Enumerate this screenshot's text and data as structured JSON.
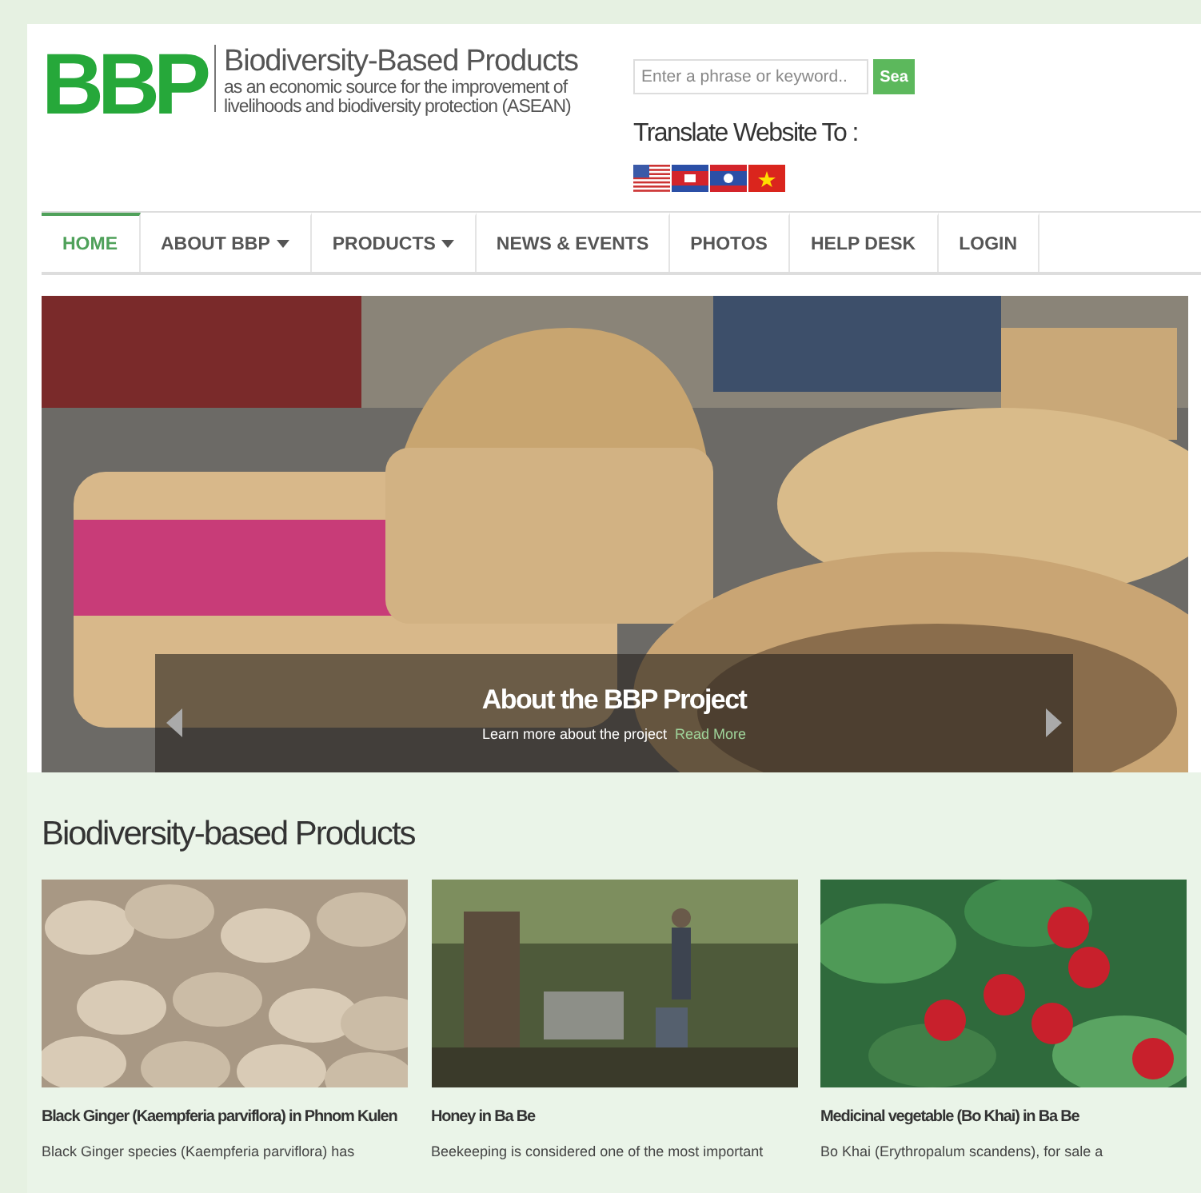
{
  "logo": {
    "mark": "BBP",
    "title": "Biodiversity-Based Products",
    "subtitle": [
      "as an economic source for the improvement of",
      "livelihoods and biodiversity protection (ASEAN)"
    ]
  },
  "search": {
    "placeholder": "Enter a phrase or keyword..",
    "button": "Sea"
  },
  "translate": {
    "label": "Translate Website To :",
    "flags": [
      {
        "kind": "us"
      },
      {
        "kind": "kh"
      },
      {
        "kind": "la"
      },
      {
        "kind": "vn"
      }
    ]
  },
  "nav": [
    {
      "label": "HOME",
      "selected": true,
      "dropdown": false
    },
    {
      "label": "ABOUT BBP",
      "selected": false,
      "dropdown": true
    },
    {
      "label": "PRODUCTS",
      "selected": false,
      "dropdown": true
    },
    {
      "label": "NEWS & EVENTS",
      "selected": false,
      "dropdown": false
    },
    {
      "label": "PHOTOS",
      "selected": false,
      "dropdown": false
    },
    {
      "label": "HELP DESK",
      "selected": false,
      "dropdown": false
    },
    {
      "label": "LOGIN",
      "selected": false,
      "dropdown": false
    }
  ],
  "slider": {
    "kind": "picture",
    "title": "About the BBP Project",
    "text": "Learn more about the project",
    "link": "Read More"
  },
  "products": {
    "heading": "Biodiversity-based Products",
    "items": [
      {
        "kind": "ginger",
        "title": "Black Ginger (Kaempferia parviflora) in Phnom Kulen",
        "text": "Black Ginger species (Kaempferia parviflora) has"
      },
      {
        "kind": "honey",
        "title": "Honey in Ba Be",
        "text": "Beekeeping is considered one of the most important"
      },
      {
        "kind": "berries",
        "title": "Medicinal vegetable (Bo Khai) in Ba Be",
        "text": "Bo Khai (Erythropalum scandens), for sale a"
      }
    ]
  }
}
